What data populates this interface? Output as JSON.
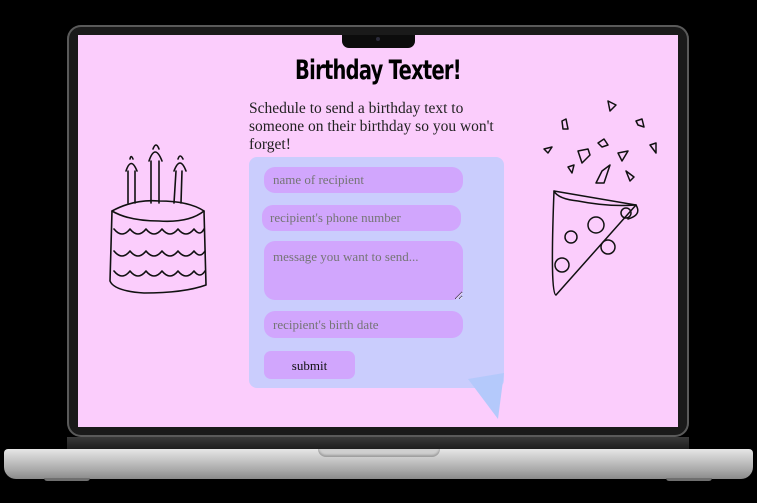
{
  "app": {
    "title": "Birthday Texter!",
    "description": "Schedule to send a birthday text to someone on their birthday so you won't forget!"
  },
  "form": {
    "recipient_name_placeholder": "name of recipient",
    "phone_placeholder": "recipient's phone number",
    "message_placeholder": "message you want to send...",
    "birth_date_placeholder": "recipient's birth date",
    "submit_label": "submit"
  },
  "icons": {
    "left": "birthday-cake-icon",
    "right": "party-popper-icon"
  },
  "colors": {
    "background": "#fbcdfc",
    "panel": "#cacdfd",
    "field": "#d1a6fd"
  }
}
